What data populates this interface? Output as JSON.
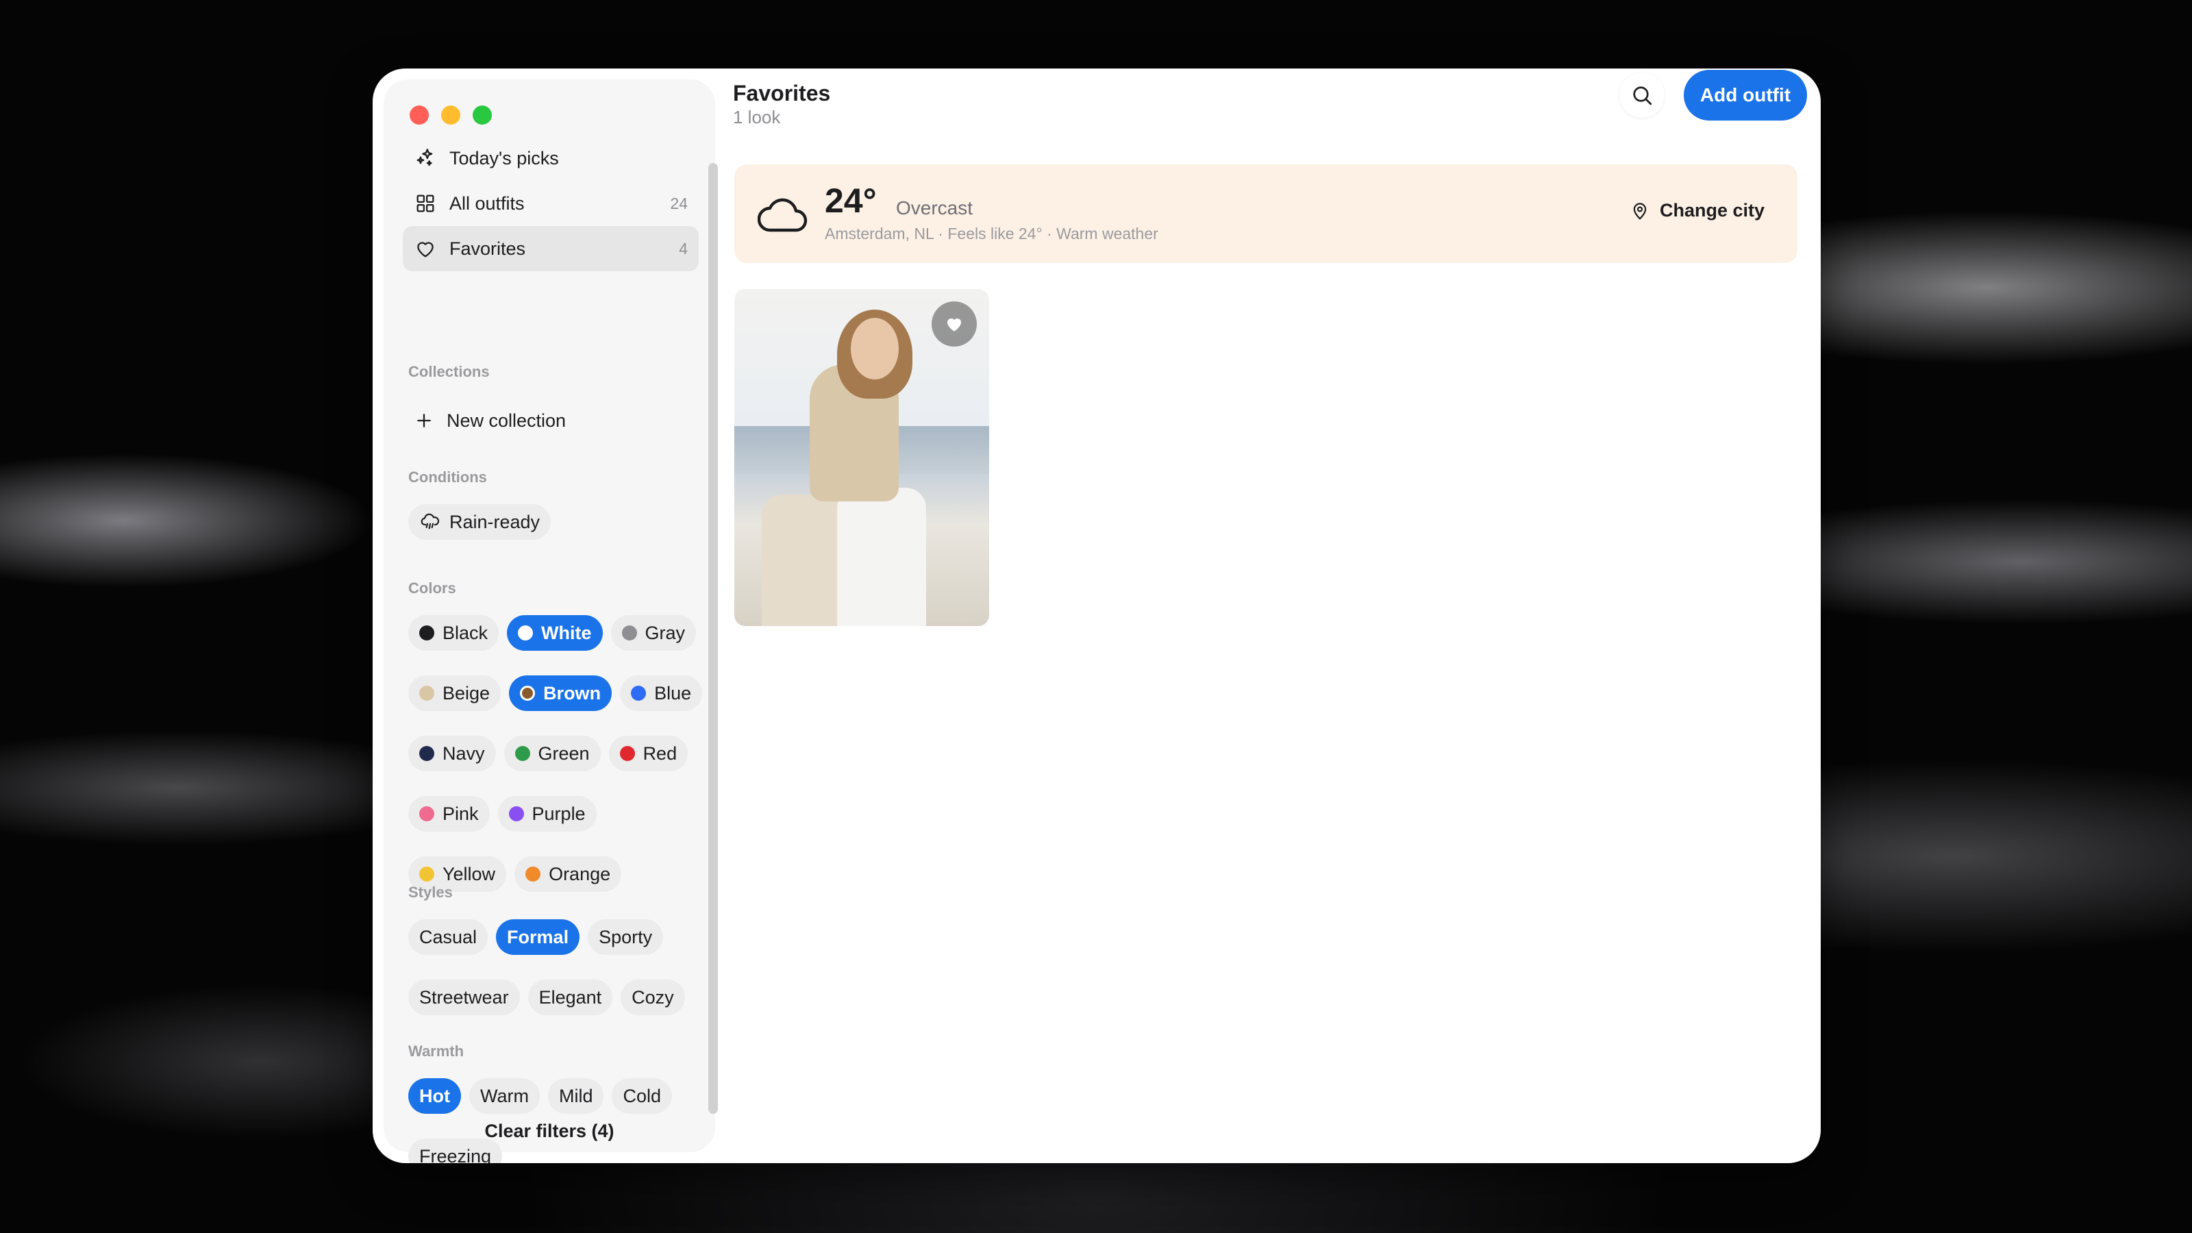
{
  "sidebar": {
    "nav": [
      {
        "label": "Today's picks",
        "count": "",
        "icon": "sparkles-icon"
      },
      {
        "label": "All outfits",
        "count": "24",
        "icon": "grid-icon"
      },
      {
        "label": "Favorites",
        "count": "4",
        "icon": "heart-icon"
      }
    ],
    "collections_title": "Collections",
    "new_collection_label": "New collection",
    "conditions_title": "Conditions",
    "conditions": [
      {
        "label": "Rain-ready",
        "icon": "rain-cloud-icon"
      }
    ],
    "colors_title": "Colors",
    "colors": [
      {
        "label": "Black",
        "color": "#1d1d1f",
        "selected": false
      },
      {
        "label": "White",
        "color": "#ffffff",
        "selected": true
      },
      {
        "label": "Gray",
        "color": "#8e8e93",
        "selected": false
      },
      {
        "label": "Beige",
        "color": "#d9c6a5",
        "selected": false
      },
      {
        "label": "Brown",
        "color": "#8b5a2b",
        "selected": true
      },
      {
        "label": "Blue",
        "color": "#2f6cf6",
        "selected": false
      },
      {
        "label": "Navy",
        "color": "#1f2a4d",
        "selected": false
      },
      {
        "label": "Green",
        "color": "#2e9b4a",
        "selected": false
      },
      {
        "label": "Red",
        "color": "#e0282e",
        "selected": false
      },
      {
        "label": "Pink",
        "color": "#ef6a8f",
        "selected": false
      },
      {
        "label": "Purple",
        "color": "#8a4ff0",
        "selected": false
      },
      {
        "label": "Yellow",
        "color": "#f2c433",
        "selected": false
      },
      {
        "label": "Orange",
        "color": "#f08a2a",
        "selected": false
      }
    ],
    "styles_title": "Styles",
    "styles": [
      {
        "label": "Casual",
        "selected": false
      },
      {
        "label": "Formal",
        "selected": true
      },
      {
        "label": "Sporty",
        "selected": false
      },
      {
        "label": "Streetwear",
        "selected": false
      },
      {
        "label": "Elegant",
        "selected": false
      },
      {
        "label": "Cozy",
        "selected": false
      }
    ],
    "warmth_title": "Warmth",
    "warmth": [
      {
        "label": "Hot",
        "selected": true
      },
      {
        "label": "Warm",
        "selected": false
      },
      {
        "label": "Mild",
        "selected": false
      },
      {
        "label": "Cold",
        "selected": false
      },
      {
        "label": "Freezing",
        "selected": false
      }
    ],
    "clear_filters_label": "Clear filters (4)"
  },
  "header": {
    "title": "Favorites",
    "subtitle": "1 look",
    "add_label": "Add outfit"
  },
  "weather": {
    "temp": "24°",
    "condition": "Overcast",
    "location_line": "Amsterdam, NL · Feels like 24° · Warm weather",
    "change_city_label": "Change city",
    "icon": "cloud-icon"
  },
  "outfits": [
    {
      "favorited": true,
      "image": "woman in beige shirt and white trousers by the sea"
    }
  ],
  "colors": {
    "accent": "#1a73e8",
    "weather_bg": "#fdf1e6"
  }
}
